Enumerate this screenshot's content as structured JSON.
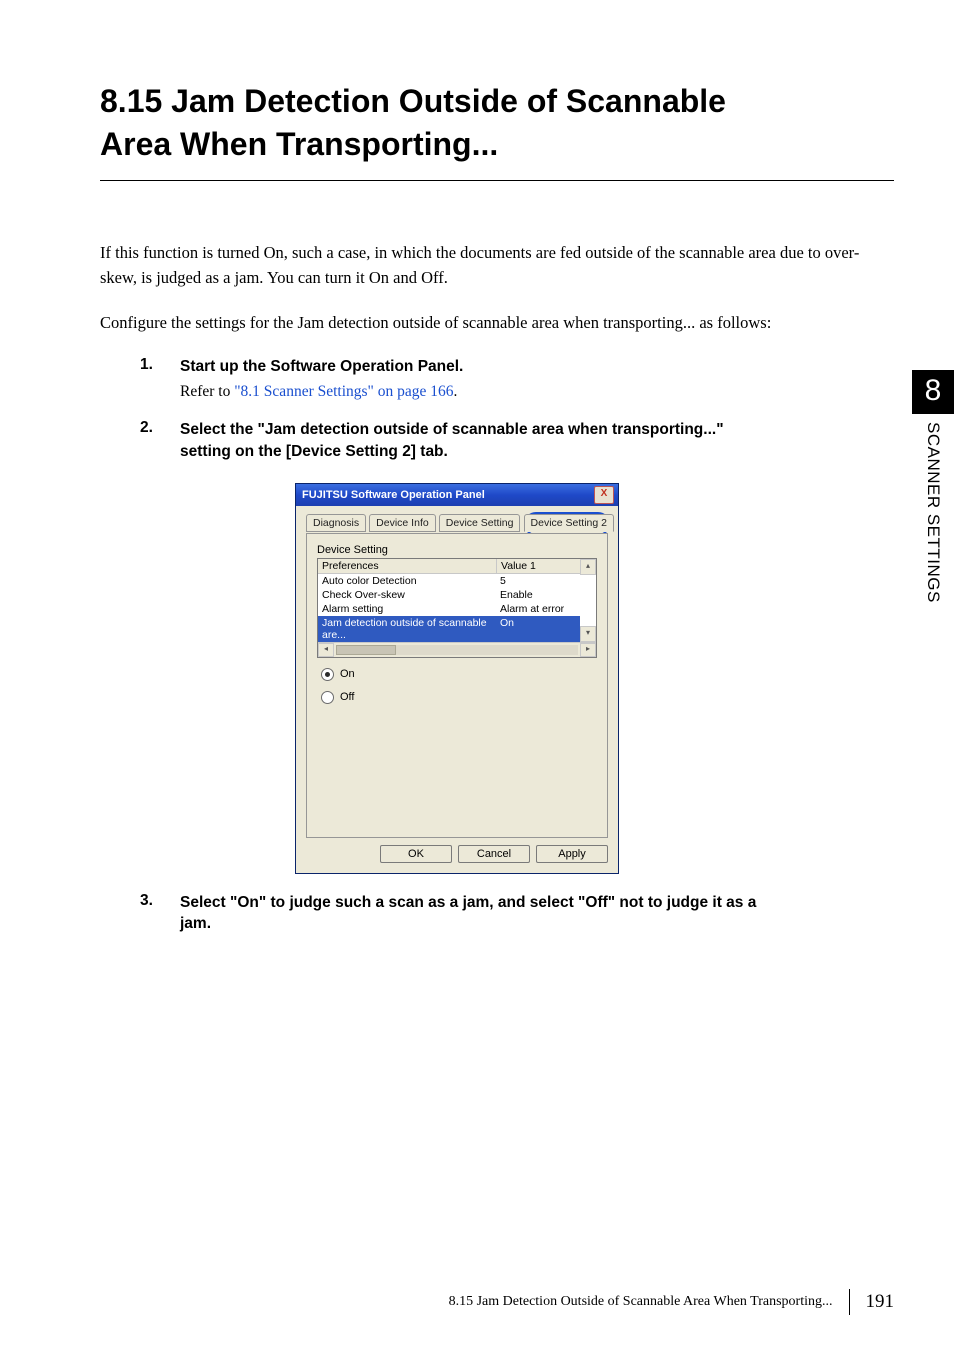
{
  "section": {
    "number": "8.15",
    "title_line1": "8.15 Jam Detection Outside of Scannable",
    "title_line2": "Area When Transporting..."
  },
  "intro_para": "If this function is turned On, such a case, in which the documents are fed outside of the scannable area due to over-skew, is judged as a jam. You can turn it On and Off.",
  "config_line": "Configure the settings for the Jam detection outside of scannable area when transporting... as follows:",
  "steps": {
    "s1": {
      "num": "1.",
      "heading": "Start up the Software Operation Panel.",
      "note_prefix": "Refer to ",
      "xref": "\"8.1 Scanner Settings\" on page 166",
      "note_suffix": "."
    },
    "s2": {
      "num": "2.",
      "heading": "Select the \"Jam detection outside of scannable area when transporting...\" setting on the [Device Setting 2] tab."
    },
    "s3": {
      "num": "3.",
      "heading": "Select \"On\" to judge such a scan as a jam, and select \"Off\" not to judge it as a jam."
    }
  },
  "dialog": {
    "title": "FUJITSU Software Operation Panel",
    "close_glyph": "X",
    "tabs": {
      "diag": "Diagnosis",
      "devinfo": "Device Info",
      "devset": "Device Setting",
      "devset2": "Device Setting 2"
    },
    "groupbox_label": "Device Setting",
    "list_header": {
      "col1": "Preferences",
      "col2": "Value 1"
    },
    "rows": [
      {
        "c1": "Auto color Detection",
        "c2": "5"
      },
      {
        "c1": "Check Over-skew",
        "c2": "Enable"
      },
      {
        "c1": "Alarm setting",
        "c2": "Alarm at error"
      },
      {
        "c1": "Jam detection outside of scannable are...",
        "c2": "On"
      }
    ],
    "radios": {
      "on": "On",
      "off": "Off",
      "selected": "on"
    },
    "buttons": {
      "ok": "OK",
      "cancel": "Cancel",
      "apply": "Apply"
    }
  },
  "side": {
    "chapter_number": "8",
    "chapter_title": "SCANNER SETTINGS"
  },
  "footer": {
    "running": "8.15 Jam Detection Outside of Scannable Area When Transporting...",
    "page": "191"
  }
}
